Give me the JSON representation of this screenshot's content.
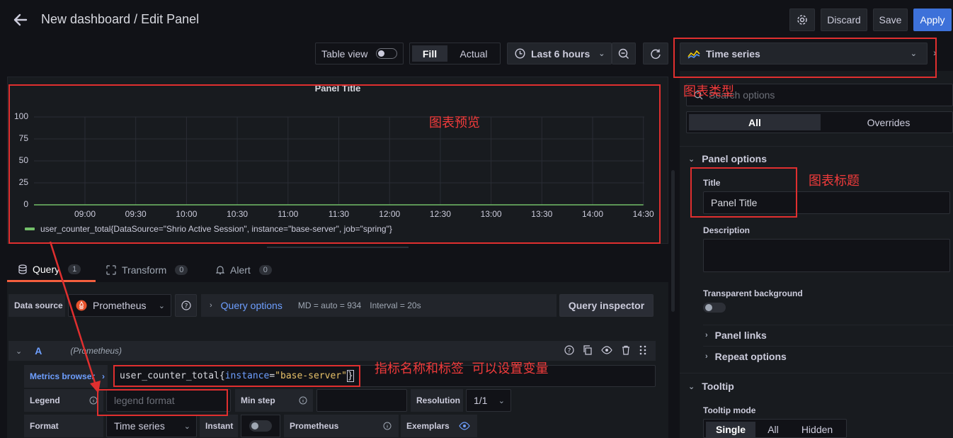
{
  "header": {
    "title": "New dashboard / Edit Panel",
    "discard_label": "Discard",
    "save_label": "Save",
    "apply_label": "Apply"
  },
  "toolbar": {
    "table_view_label": "Table view",
    "fill_label": "Fill",
    "actual_label": "Actual",
    "time_range_label": "Last 6 hours",
    "visualization_label": "Time series"
  },
  "panel": {
    "title": "Panel Title",
    "y_ticks": [
      "100",
      "75",
      "50",
      "25",
      "0"
    ],
    "x_ticks": [
      "09:00",
      "09:30",
      "10:00",
      "10:30",
      "11:00",
      "11:30",
      "12:00",
      "12:30",
      "13:00",
      "13:30",
      "14:00",
      "14:30"
    ],
    "legend": "user_counter_total{DataSource=\"Shrio Active Session\", instance=\"base-server\", job=\"spring\"}",
    "series_color": "#73bf69"
  },
  "chart_data": {
    "type": "line",
    "title": "Panel Title",
    "ylim": [
      0,
      100
    ],
    "x": [
      "09:00",
      "09:30",
      "10:00",
      "10:30",
      "11:00",
      "11:30",
      "12:00",
      "12:30",
      "13:00",
      "13:30",
      "14:00",
      "14:30"
    ],
    "series": [
      {
        "name": "user_counter_total{DataSource=\"Shrio Active Session\", instance=\"base-server\", job=\"spring\"}",
        "values": [
          0,
          0,
          0,
          0,
          0,
          0,
          0,
          0,
          0,
          0,
          0,
          0
        ]
      }
    ],
    "grid": true,
    "legend_position": "bottom-left"
  },
  "tabs": [
    {
      "label": "Query",
      "count": "1"
    },
    {
      "label": "Transform",
      "count": "0"
    },
    {
      "label": "Alert",
      "count": "0"
    }
  ],
  "query": {
    "data_source_label": "Data source",
    "data_source_value": "Prometheus",
    "query_options_label": "Query options",
    "md_text": "MD = auto = 934",
    "interval_text": "Interval = 20s",
    "inspector_label": "Query inspector",
    "row_letter": "A",
    "row_source": "(Prometheus)",
    "metrics_browser_label": "Metrics browser",
    "expr_metric": "user_counter_total{",
    "expr_key": "instance",
    "expr_eq": "=",
    "expr_value": "\"base-server\"",
    "expr_close": "}",
    "legend_label": "Legend",
    "legend_placeholder": "legend format",
    "min_step_label": "Min step",
    "resolution_label": "Resolution",
    "resolution_value": "1/1",
    "format_label": "Format",
    "format_value": "Time series",
    "instant_label": "Instant",
    "prometheus_label": "Prometheus",
    "exemplars_label": "Exemplars"
  },
  "options": {
    "search_placeholder": "Search options",
    "all_label": "All",
    "overrides_label": "Overrides",
    "panel_options_label": "Panel options",
    "title_label": "Title",
    "title_value": "Panel Title",
    "description_label": "Description",
    "transparent_label": "Transparent background",
    "panel_links_label": "Panel links",
    "repeat_options_label": "Repeat options",
    "tooltip_label": "Tooltip",
    "tooltip_mode_label": "Tooltip mode",
    "tooltip_modes": [
      "Single",
      "All",
      "Hidden"
    ]
  },
  "annotations": {
    "chart_type": "图表类型",
    "chart_preview": "图表预览",
    "chart_title": "图表标题",
    "metric_labels": "指标名称和标签  可以设置变量"
  },
  "colors": {
    "accent": "#3d71d9",
    "annotation_red": "#e02f2f",
    "link_blue": "#6e9fff"
  }
}
